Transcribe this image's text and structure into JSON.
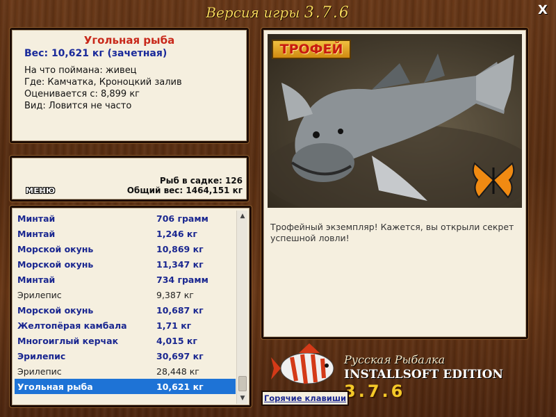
{
  "window": {
    "title_prefix": "Версия игры",
    "title_version": "3.7.6",
    "close_label": "X"
  },
  "fish_info": {
    "name": "Угольная рыба",
    "weight_line": "Вес: 10,621 кг (зачетная)",
    "bait": "На что поймана: живец",
    "location": "Где: Камчатка, Кроноцкий залив",
    "rated_from": "Оценивается с: 8,899 кг",
    "rarity": "Вид: Ловится не часто"
  },
  "summary": {
    "menu_label": "МЕНЮ",
    "fish_count": "Рыб в садке: 126",
    "total_weight": "Общий вес: 1464,151 кг"
  },
  "catch_list": {
    "rows": [
      {
        "name": "Минтай",
        "weight": "706 грамм",
        "style": "bold"
      },
      {
        "name": "Минтай",
        "weight": "1,246 кг",
        "style": "bold"
      },
      {
        "name": "Морской окунь",
        "weight": "10,869 кг",
        "style": "bold"
      },
      {
        "name": "Морской окунь",
        "weight": "11,347 кг",
        "style": "bold"
      },
      {
        "name": "Минтай",
        "weight": "734 грамм",
        "style": "bold"
      },
      {
        "name": "Эрилепис",
        "weight": "9,387 кг",
        "style": "plain"
      },
      {
        "name": "Морской окунь",
        "weight": "10,687 кг",
        "style": "bold"
      },
      {
        "name": "Желтопёрая камбала",
        "weight": "1,71 кг",
        "style": "bold"
      },
      {
        "name": "Многоиглый керчак",
        "weight": "4,015 кг",
        "style": "bold"
      },
      {
        "name": "Эрилепис",
        "weight": "30,697 кг",
        "style": "bold"
      },
      {
        "name": "Эрилепис",
        "weight": "28,448 кг",
        "style": "plain"
      },
      {
        "name": "Угольная рыба",
        "weight": "10,621 кг",
        "style": "sel"
      }
    ],
    "scroll_up_icon": "triangle-up",
    "scroll_down_icon": "triangle-down"
  },
  "photo": {
    "badge": "ТРОФЕЙ",
    "description": "Трофейный экземпляр! Кажется, вы открыли секрет успешной ловли!"
  },
  "footer": {
    "hotkeys_label": "Горячие клавиши",
    "brand_ru": "Русская Рыбалка",
    "brand_en": "INSTALLSOFT EDITION",
    "brand_version": "3.7.6"
  },
  "colors": {
    "title_gold": "#f2d45a",
    "fish_name_red": "#c8281a",
    "list_blue": "#1a2790",
    "selection_blue": "#1e73d6"
  }
}
